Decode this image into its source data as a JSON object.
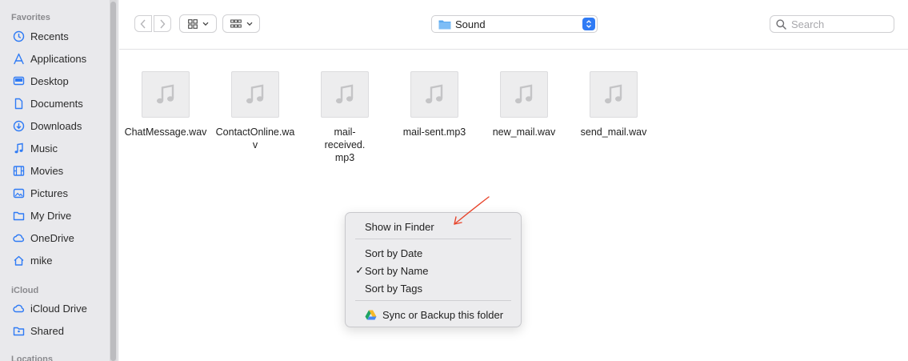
{
  "sidebar": {
    "favorites_label": "Favorites",
    "favorites": [
      {
        "label": "Recents",
        "icon": "clock-icon"
      },
      {
        "label": "Applications",
        "icon": "applications-icon"
      },
      {
        "label": "Desktop",
        "icon": "desktop-icon"
      },
      {
        "label": "Documents",
        "icon": "document-icon"
      },
      {
        "label": "Downloads",
        "icon": "download-icon"
      },
      {
        "label": "Music",
        "icon": "music-note-icon"
      },
      {
        "label": "Movies",
        "icon": "film-icon"
      },
      {
        "label": "Pictures",
        "icon": "picture-icon"
      },
      {
        "label": "My Drive",
        "icon": "folder-icon"
      },
      {
        "label": "OneDrive",
        "icon": "cloud-icon"
      },
      {
        "label": "mike",
        "icon": "home-icon"
      }
    ],
    "icloud_label": "iCloud",
    "icloud": [
      {
        "label": "iCloud Drive",
        "icon": "cloud-icon"
      },
      {
        "label": "Shared",
        "icon": "shared-folder-icon"
      }
    ],
    "locations_label": "Locations",
    "accent_color": "#2f7bf5"
  },
  "toolbar": {
    "path_folder": "Sound",
    "search_placeholder": "Search"
  },
  "files": [
    {
      "name": "ChatMessage.wav"
    },
    {
      "name": "ContactOnline.wav"
    },
    {
      "name": "mail-received.mp3"
    },
    {
      "name": "mail-sent.mp3"
    },
    {
      "name": "new_mail.wav"
    },
    {
      "name": "send_mail.wav"
    }
  ],
  "context_menu": {
    "show_in_finder": "Show in Finder",
    "sort_by_date": "Sort by Date",
    "sort_by_name": "Sort by Name",
    "sort_by_tags": "Sort by Tags",
    "sync_backup": "Sync or Backup this folder",
    "checkmark": "✓",
    "checked_item": "sort_by_name"
  },
  "annotation_color": "#e8452c"
}
